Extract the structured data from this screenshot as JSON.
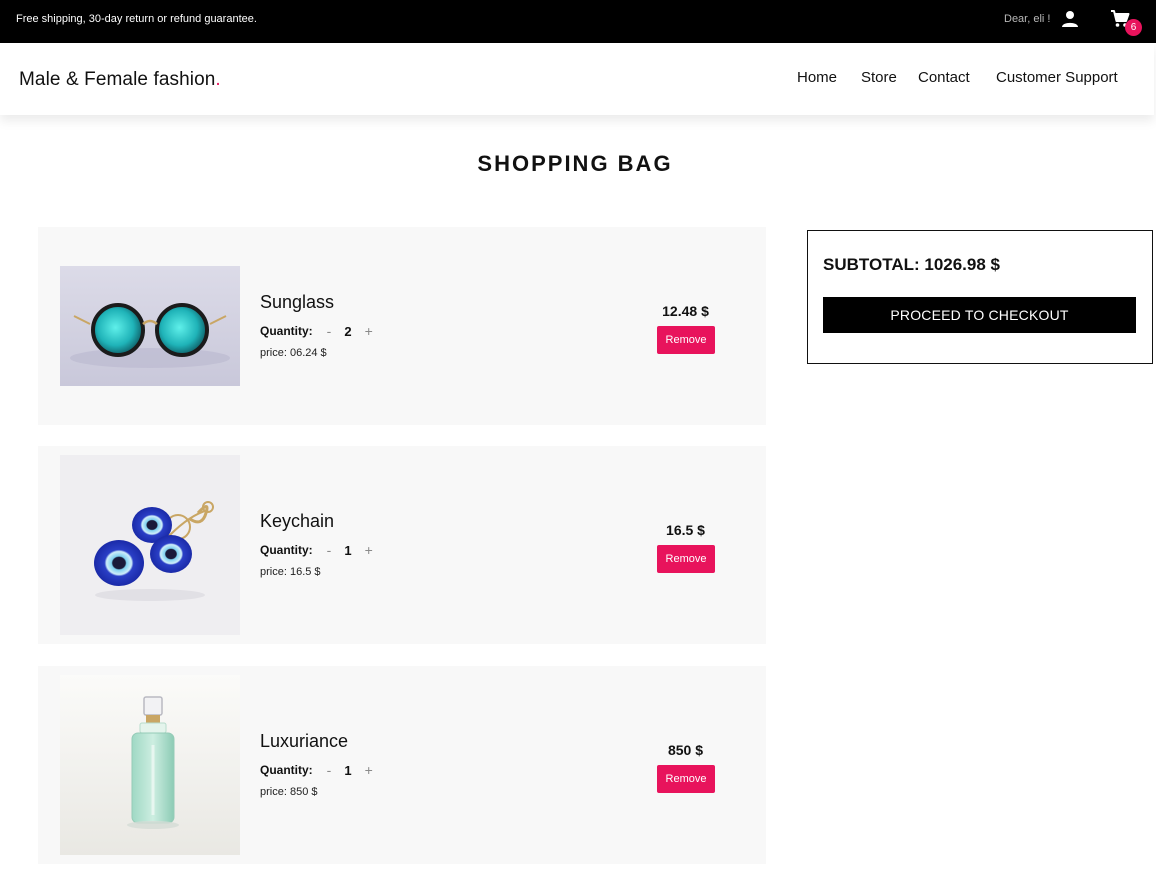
{
  "topbar": {
    "shipping_text": "Free shipping, 30-day return or refund guarantee.",
    "greeting": "Dear, eli !",
    "cart_count": "6",
    "user_icon": "user-icon",
    "cart_icon": "shopping-cart-icon"
  },
  "navbar": {
    "logo": "Male & Female fashion",
    "logo_dot": ".",
    "links": [
      "Home",
      "Store",
      "Contact",
      "Customer Support"
    ]
  },
  "page": {
    "title": "SHOPPING BAG"
  },
  "cart": {
    "quantity_label": "Quantity:",
    "minus_symbol": "-",
    "plus_symbol": "+",
    "remove_label": "Remove",
    "items": [
      {
        "name": "Sunglass",
        "quantity": "2",
        "unit_price": "price: 06.24 $",
        "total": "12.48 $"
      },
      {
        "name": "Keychain",
        "quantity": "1",
        "unit_price": "price: 16.5 $",
        "total": "16.5 $"
      },
      {
        "name": "Luxuriance",
        "quantity": "1",
        "unit_price": "price: 850 $",
        "total": "850 $"
      }
    ]
  },
  "summary": {
    "subtotal": "SUBTOTAL: 1026.98 $",
    "checkout_label": "PROCEED TO CHECKOUT"
  },
  "colors": {
    "accent": "#e8135c",
    "topbar": "#000000",
    "card_bg": "#f8f8f8"
  }
}
